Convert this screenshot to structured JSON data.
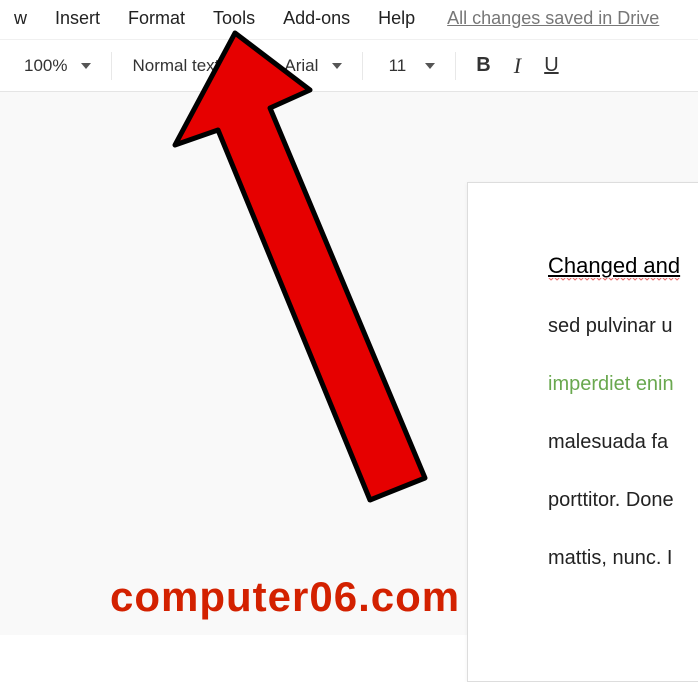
{
  "menubar": {
    "items": [
      {
        "label": "w"
      },
      {
        "label": "Insert"
      },
      {
        "label": "Format"
      },
      {
        "label": "Tools"
      },
      {
        "label": "Add-ons"
      },
      {
        "label": "Help"
      }
    ],
    "save_status": "All changes saved in Drive"
  },
  "toolbar": {
    "zoom": "100%",
    "style": "Normal text",
    "font": "Arial",
    "font_size": "11",
    "bold": "B",
    "italic": "I",
    "underline": "U"
  },
  "document": {
    "title": "Changed and",
    "line1": "sed pulvinar u",
    "line2": "imperdiet enin",
    "line3": "malesuada fa",
    "line4": "porttitor. Done",
    "line5": "mattis, nunc. I"
  },
  "annotation": {
    "arrow_color": "#e60000",
    "arrow_stroke": "#000000"
  },
  "watermark": "computer06.com"
}
